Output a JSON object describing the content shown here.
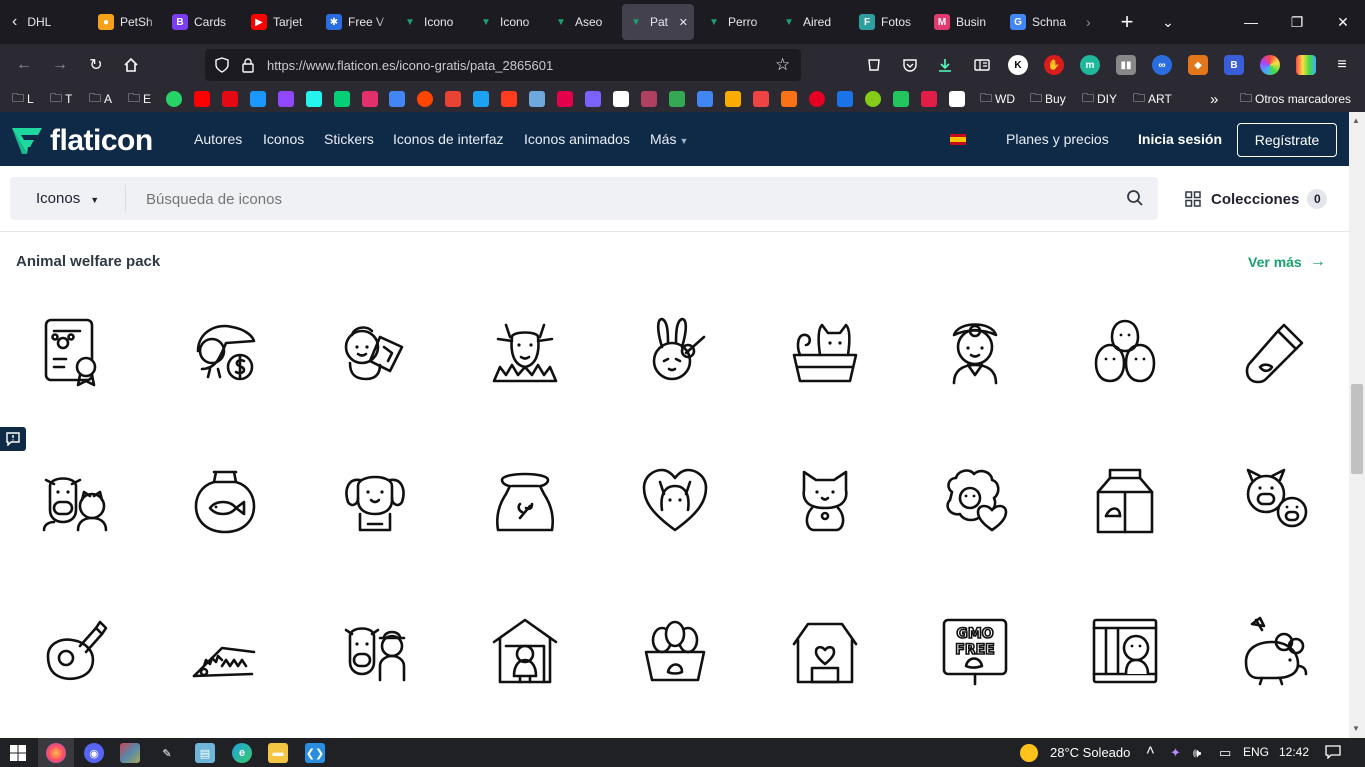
{
  "browser": {
    "tabs": [
      {
        "label": "DHL",
        "color": "#1c1b22",
        "glyph": "‹"
      },
      {
        "label": "PetSh",
        "color": "#f6a11a",
        "glyph": "●"
      },
      {
        "label": "Cards",
        "color": "#7a3cf0",
        "glyph": "B"
      },
      {
        "label": "Tarjet",
        "color": "#ff0000",
        "glyph": "▶"
      },
      {
        "label": "Free V",
        "color": "#2a6de0",
        "glyph": "✱"
      },
      {
        "label": "Icono",
        "color": "#1aa06d",
        "glyph": "▼"
      },
      {
        "label": "Icono",
        "color": "#1aa06d",
        "glyph": "▼"
      },
      {
        "label": "Aseo",
        "color": "#1aa06d",
        "glyph": "▼"
      },
      {
        "label": "Pat",
        "color": "#1aa06d",
        "glyph": "▼",
        "active": true
      },
      {
        "label": "Perro",
        "color": "#1aa06d",
        "glyph": "▼"
      },
      {
        "label": "Aired",
        "color": "#1aa06d",
        "glyph": "▼"
      },
      {
        "label": "Fotos",
        "color": "#2f9e9e",
        "glyph": "F"
      },
      {
        "label": "Busin",
        "color": "#e03a6e",
        "glyph": "M"
      },
      {
        "label": "Schna",
        "color": "#4285f4",
        "glyph": "G"
      }
    ],
    "new_tab": "+",
    "tab_list": "⌄",
    "window": {
      "minimize": "—",
      "maximize": "❐",
      "close": "✕"
    },
    "url": "https://www.flaticon.es/icono-gratis/pata_2865601",
    "bookmarks": [
      {
        "label": "L"
      },
      {
        "label": "T"
      },
      {
        "label": "A"
      },
      {
        "label": "E"
      },
      {
        "label": "WD"
      },
      {
        "label": "Buy"
      },
      {
        "label": "DIY"
      },
      {
        "label": "ART"
      }
    ],
    "other_bookmarks": "Otros marcadores",
    "more_bookmarks": "»"
  },
  "site": {
    "logo": "flaticon",
    "menu": [
      "Autores",
      "Iconos",
      "Stickers",
      "Iconos de interfaz",
      "Iconos animados",
      "Más"
    ],
    "plans": "Planes y precios",
    "login": "Inicia sesión",
    "signup": "Regístrate",
    "search": {
      "type": "Iconos",
      "placeholder": "Búsqueda de iconos"
    },
    "collections": {
      "label": "Colecciones",
      "count": "0"
    },
    "pack_title": "Animal welfare pack",
    "see_more": "Ver más"
  },
  "icons": [
    "certificate-icon",
    "toucan-money-icon",
    "monkey-sign-icon",
    "goat-icon",
    "rabbit-icon",
    "cat-basket-icon",
    "vet-doctor-icon",
    "chicks-icon",
    "lipstick-icon",
    "cow-friends-icon",
    "fishbowl-icon",
    "dog-icon",
    "feed-sack-icon",
    "heart-animal-icon",
    "cat-sitting-icon",
    "sheep-heart-icon",
    "milk-carton-icon",
    "pigs-icon",
    "steak-icon",
    "trap-icon",
    "cow-farmer-icon",
    "chicken-coop-icon",
    "egg-basket-icon",
    "barn-icon",
    "gmo-free-sign-icon",
    "caged-monkey-icon",
    "mouse-icon"
  ],
  "gmo_text": [
    "GMO",
    "FREE"
  ],
  "taskbar": {
    "weather": "28°C  Soleado",
    "lang": "ENG",
    "time": "12:42"
  },
  "colors": {
    "brand": "#0e2a47",
    "accent": "#1aa06d"
  }
}
